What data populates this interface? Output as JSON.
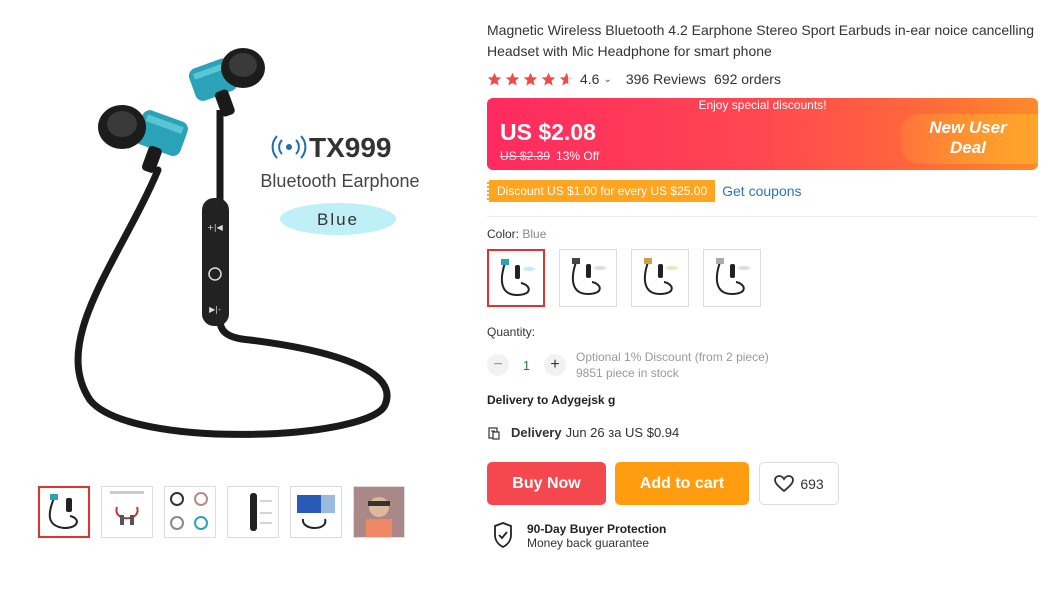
{
  "product": {
    "title": "Magnetic Wireless Bluetooth 4.2 Earphone Stereo Sport Earbuds in-ear noice cancelling Headset with Mic Headphone for smart phone",
    "image_brand": "TX999",
    "image_subtitle": "Bluetooth Earphone",
    "image_color_tag": "Blue"
  },
  "rating": {
    "value": "4.6",
    "stars": 4.6,
    "reviews": "396 Reviews",
    "orders": "692 orders"
  },
  "price": {
    "enjoy_text": "Enjoy special discounts!",
    "current": "US $2.08",
    "original": "US $2.39",
    "discount": "13% Off",
    "new_user": "New User Deal"
  },
  "coupon": {
    "text": "Discount US $1.00 for every US $25.00",
    "link": "Get coupons"
  },
  "color": {
    "label": "Color:",
    "selected": "Blue"
  },
  "quantity": {
    "label": "Quantity:",
    "value": "1",
    "note1": "Optional 1% Discount (from 2 piece)",
    "note2": "9851 piece in stock"
  },
  "delivery": {
    "to": "Delivery to Adygejsk g",
    "label": "Delivery",
    "detail": "Jun 26 за US $0.94"
  },
  "actions": {
    "buy_now": "Buy Now",
    "add_to_cart": "Add to cart",
    "wishlist_count": "693"
  },
  "protection": {
    "title": "90-Day Buyer Protection",
    "subtitle": "Money back guarantee"
  },
  "colors": {
    "accent": "#e0332e",
    "buy": "#f5484e",
    "cart": "#ff9c0f",
    "coupon": "#ffa51f",
    "link": "#2e75b5"
  }
}
